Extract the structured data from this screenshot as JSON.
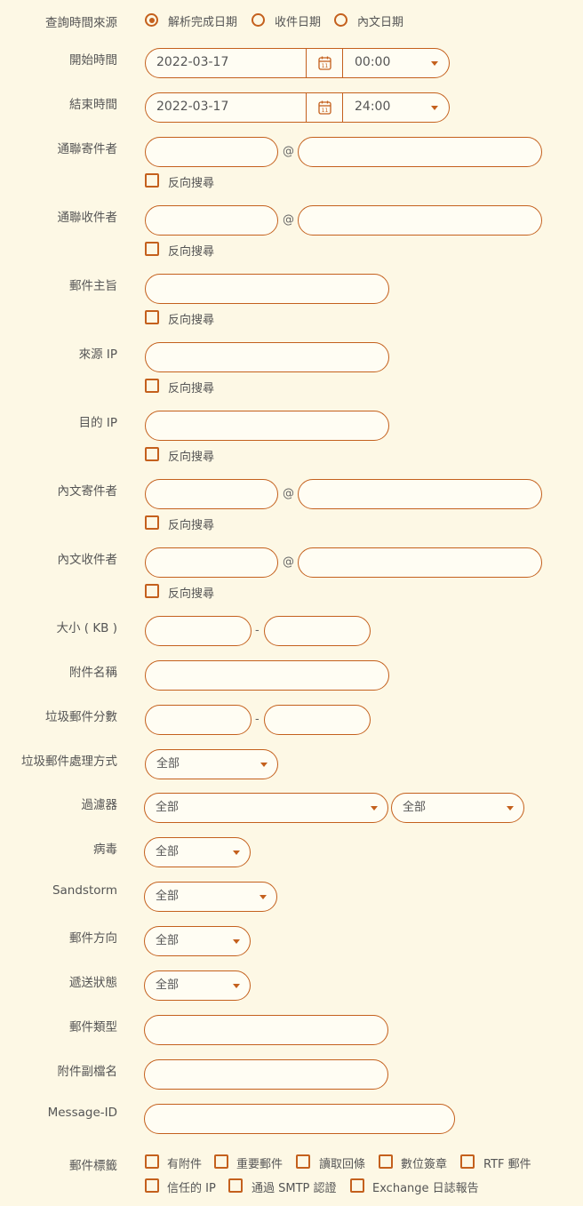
{
  "query_source": {
    "label": "查詢時間來源",
    "options": [
      {
        "label": "解析完成日期",
        "checked": true
      },
      {
        "label": "收件日期",
        "checked": false
      },
      {
        "label": "內文日期",
        "checked": false
      }
    ]
  },
  "start": {
    "label": "開始時間",
    "date": "2022-03-17",
    "time": "00:00"
  },
  "end": {
    "label": "結束時間",
    "date": "2022-03-17",
    "time": "24:00"
  },
  "reverse_label": "反向搜尋",
  "at_sign": "@",
  "dash": "-",
  "fields": {
    "envelope_sender": "通聯寄件者",
    "envelope_recipient": "通聯收件者",
    "subject": "郵件主旨",
    "source_ip": "來源 IP",
    "dest_ip": "目的 IP",
    "header_sender": "內文寄件者",
    "header_recipient": "內文收件者",
    "size": "大小 ( KB )",
    "attachment_name": "附件名稱",
    "spam_score": "垃圾郵件分數",
    "spam_action": "垃圾郵件處理方式",
    "filter": "過濾器",
    "virus": "病毒",
    "sandstorm": "Sandstorm",
    "direction": "郵件方向",
    "delivery_status": "遞送狀態",
    "mail_type": "郵件類型",
    "attachment_ext": "附件副檔名",
    "message_id": "Message-ID",
    "mail_tags": "郵件標籤"
  },
  "select_all": "全部",
  "tags": [
    "有附件",
    "重要郵件",
    "讀取回條",
    "數位簽章",
    "RTF 郵件",
    "信任的 IP",
    "通過 SMTP 認證",
    "Exchange 日誌報告"
  ],
  "colors": {
    "accent": "#c4601d",
    "background": "#fdf8e5"
  }
}
